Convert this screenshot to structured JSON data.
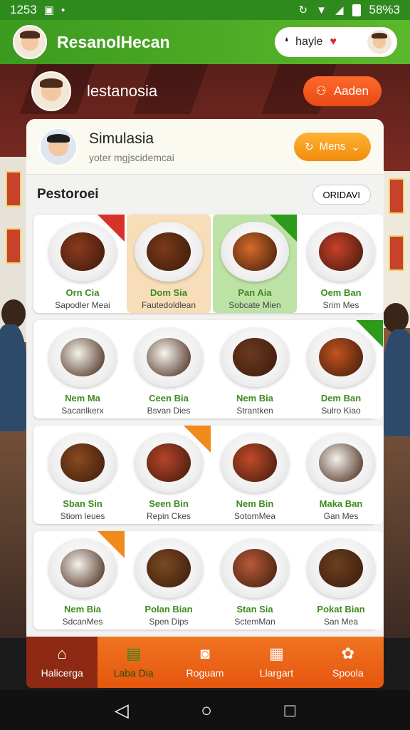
{
  "status_bar": {
    "time": "1253",
    "battery": "58%3"
  },
  "header": {
    "title": "ResanolHecan",
    "pill_label": "hayle"
  },
  "user_row": {
    "name": "lestanosia",
    "button_label": "Aaden"
  },
  "card_header": {
    "title": "Simulasia",
    "subtitle": "yoter mgjscidemcai",
    "menu_label": "Mens"
  },
  "section": {
    "title": "Pestoroei",
    "chip_label": "ORIDAVI"
  },
  "rows": [
    [
      {
        "name": "Orn Cia",
        "sub": "Sapodler Meai",
        "bg": "#ffffff",
        "tag": "#d6322a",
        "food": "#8b3a1e"
      },
      {
        "name": "Dom Sia",
        "sub": "Fautedoldlean",
        "bg": "#f7ddb8",
        "tag": "",
        "food": "#7a3a1a"
      },
      {
        "name": "Pan Aia",
        "sub": "Sobcate Mien",
        "bg": "#bde2a6",
        "tag": "#2e9a1a",
        "food": "#d56a2a"
      },
      {
        "name": "Oem Ban",
        "sub": "Srim Mes",
        "bg": "#ffffff",
        "tag": "",
        "food": "#c9402a"
      }
    ],
    [
      {
        "name": "Nem Ma",
        "sub": "Sacanlkerx",
        "bg": "#ffffff",
        "tag": "",
        "food": "#f6f3ea"
      },
      {
        "name": "Ceen Bia",
        "sub": "Bsvan Dies",
        "bg": "#ffffff",
        "tag": "",
        "food": "#f7f5ee"
      },
      {
        "name": "Nem Bia",
        "sub": "Strantken",
        "bg": "#ffffff",
        "tag": "",
        "food": "#6b3a20"
      },
      {
        "name": "Dem Ban",
        "sub": "Sulro Kiao",
        "bg": "#ffffff",
        "tag": "#2e9a1a",
        "food": "#c2531f"
      }
    ],
    [
      {
        "name": "Sban Sin",
        "sub": "Stiom leues",
        "bg": "#ffffff",
        "tag": "",
        "food": "#8a4a20"
      },
      {
        "name": "Seen Bin",
        "sub": "Repin Ckes",
        "bg": "#ffffff",
        "tag": "#f08a1a",
        "food": "#b8442a"
      },
      {
        "name": "Nem Bin",
        "sub": "SotomMea",
        "bg": "#ffffff",
        "tag": "",
        "food": "#c24a2a"
      },
      {
        "name": "Maka Ban",
        "sub": "Gan Mes",
        "bg": "#ffffff",
        "tag": "",
        "food": "#f4f2ec"
      }
    ],
    [
      {
        "name": "Nem Bia",
        "sub": "SdcanMes",
        "bg": "#ffffff",
        "tag": "#f08a1a",
        "food": "#f5f3ed"
      },
      {
        "name": "Polan Bian",
        "sub": "Spen Dips",
        "bg": "#ffffff",
        "tag": "",
        "food": "#7a4a22"
      },
      {
        "name": "Stan Sia",
        "sub": "SctemMan",
        "bg": "#ffffff",
        "tag": "",
        "food": "#b85a3a"
      },
      {
        "name": "Pokat Bian",
        "sub": "San Mea",
        "bg": "#ffffff",
        "tag": "",
        "food": "#6a4020"
      }
    ]
  ],
  "bottom_nav": [
    {
      "label": "Halicerga",
      "icon": "home-icon"
    },
    {
      "label": "Laba Dia",
      "icon": "bag-icon"
    },
    {
      "label": "Roguam",
      "icon": "camera-icon"
    },
    {
      "label": "Llargart",
      "icon": "document-icon"
    },
    {
      "label": "Spoola",
      "icon": "gear-icon"
    }
  ],
  "colors": {
    "brand_green": "#3c9a1f",
    "accent_orange": "#f07420",
    "active_nav": "#8e2a14",
    "name_green": "#3d8b1f"
  }
}
